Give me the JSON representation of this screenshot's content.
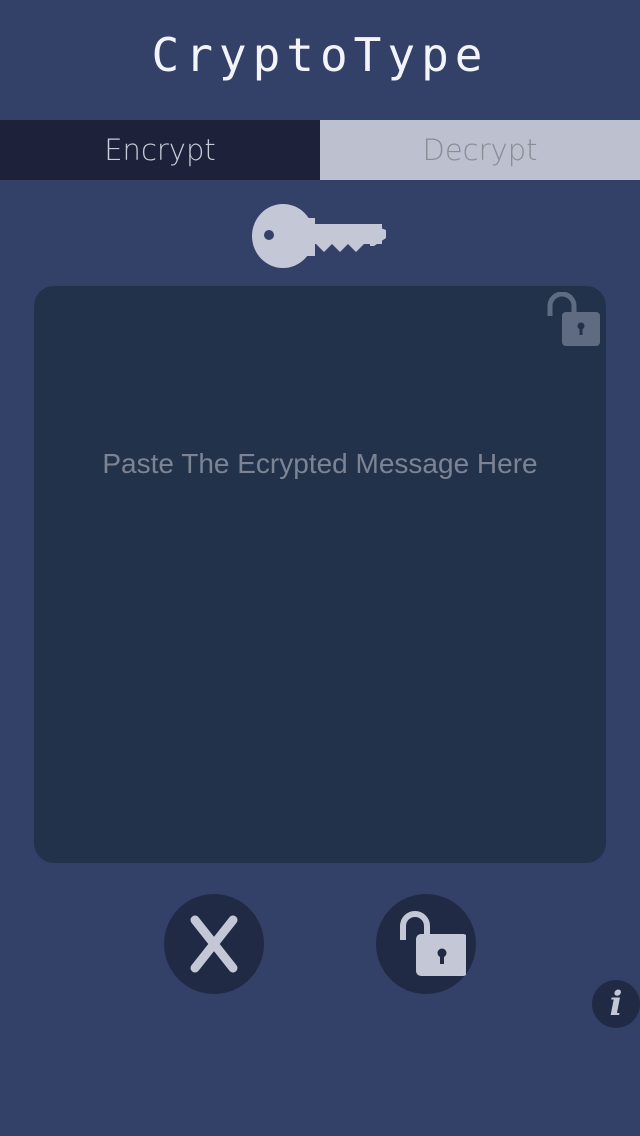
{
  "app": {
    "title": "CryptoType"
  },
  "tabs": [
    {
      "label": "Encrypt",
      "active": true
    },
    {
      "label": "Decrypt",
      "active": false
    }
  ],
  "message_box": {
    "placeholder": "Paste The Ecrypted Message Here",
    "value": ""
  },
  "icons": {
    "key": "key-icon",
    "corner": "unlock-icon",
    "clear": "close-icon",
    "action": "unlock-icon",
    "info": "info-icon"
  },
  "info_label": "i",
  "colors": {
    "background": "#334068",
    "active_tab": "#1d2139",
    "inactive_tab": "#bcc0cf",
    "box": "#22324b",
    "icon": "#c4c8d6"
  }
}
